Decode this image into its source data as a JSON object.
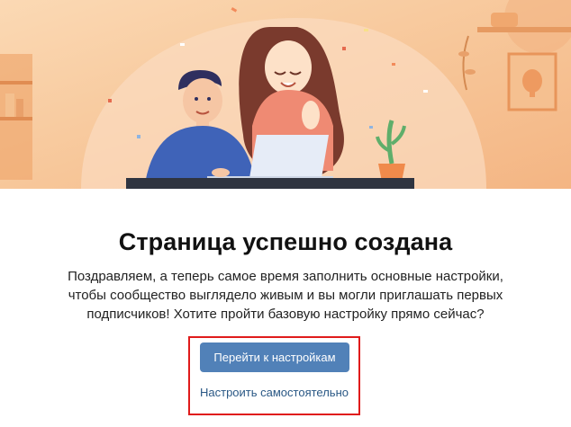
{
  "dialog": {
    "title": "Страница успешно создана",
    "description": "Поздравляем, а теперь самое время заполнить основные настройки, чтобы сообщество выглядело живым и вы могли приглашать первых подписчиков! Хотите пройти базовую настройку прямо сейчас?",
    "primary_button_label": "Перейти к настройкам",
    "secondary_link_label": "Настроить самостоятельно"
  },
  "illustration": {
    "icon": "people-at-laptop-illustration"
  },
  "colors": {
    "hero_background": "#f8caa0",
    "primary_button": "#5181b8",
    "link": "#2a5885",
    "highlight_border": "#e01b1b"
  }
}
